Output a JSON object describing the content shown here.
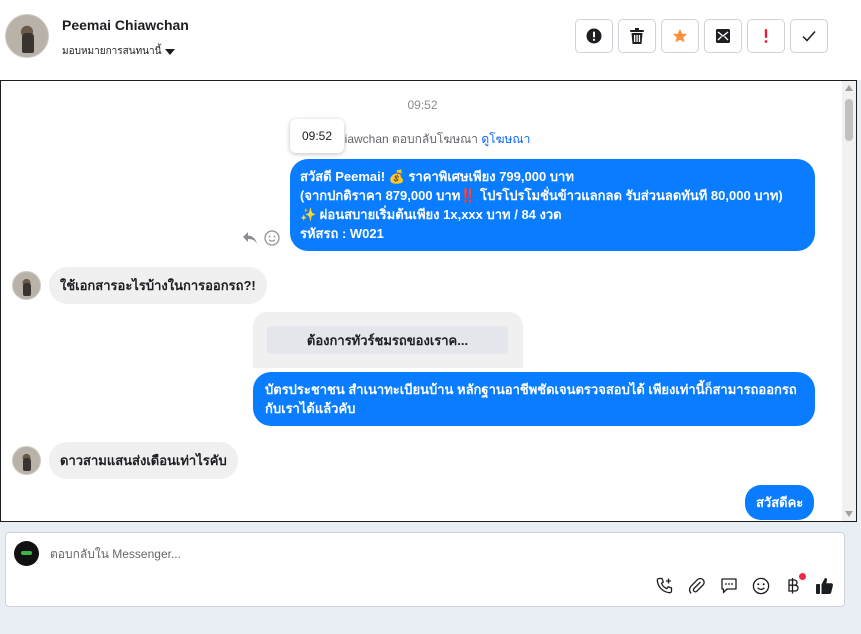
{
  "header": {
    "contact_name": "Peemai Chiawchan",
    "assign_label": "มอบหมายการสนทนานี้",
    "actions": [
      {
        "name": "mark-spam-button",
        "icon": "alert-circle-icon"
      },
      {
        "name": "delete-button",
        "icon": "trash-icon"
      },
      {
        "name": "star-button",
        "icon": "star-icon",
        "color": "#f7923b"
      },
      {
        "name": "move-to-inbox-button",
        "icon": "envelope-icon"
      },
      {
        "name": "follow-up-button",
        "icon": "exclamation-icon",
        "color": "#e41e3f"
      },
      {
        "name": "mark-done-button",
        "icon": "check-icon"
      }
    ]
  },
  "chat": {
    "time_separator": "09:52",
    "tooltip_time": "09:52",
    "replied_prefix": "hiawchan ตอบกลับโฆษณา",
    "replied_link": "ดูโฆษณา",
    "messages": {
      "ad_line1": "สวัสดี Peemai! 💰 ราคาพิเศษเพียง 799,000 บาท",
      "ad_line2": "(จากปกติราคา 879,000 บาท‼️ โปรโปรโมชั่นข้าวแลกลด รับส่วนลดทันที 80,000 บาท)",
      "ad_line3": "✨ ผ่อนสบายเริ่มต้นเพียง 1x,xxx บาท / 84 งวด",
      "ad_line4": " รหัสรถ : W021",
      "incoming_1": "ใช้เอกสารอะไรบ้างในการออกรถ?!",
      "card_button": "ต้องการทัวร์ชมรถของเราค...",
      "outgoing_2": "บัตรประชาชน สำเนาทะเบียนบ้าน หลักฐานอาชีพชัดเจนตรวจสอบได้ เพียงเท่านี้ก็สามารถออกรถกับเราได้แล้วคับ",
      "incoming_2": "ดาวสามแสนส่งเดือนเท่าไรคับ",
      "outgoing_3": "สวัสดีคะ"
    }
  },
  "composer": {
    "placeholder": "ตอบกลับใน Messenger..."
  },
  "colors": {
    "outgoing_bubble": "#0a7cff",
    "incoming_bubble": "#f0f0f0",
    "link": "#0866ff"
  }
}
